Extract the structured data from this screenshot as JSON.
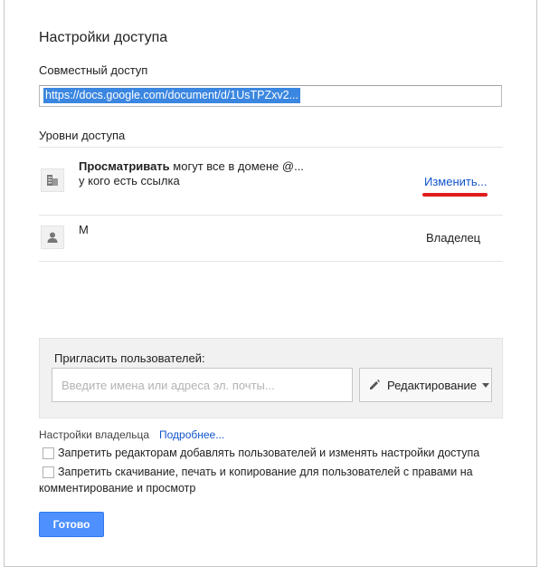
{
  "dialog": {
    "title": "Настройки доступа",
    "share_link": {
      "label": "Совместный доступ",
      "value": "https://docs.google.com/document/d/1UsTPZxv2..."
    },
    "access_levels": {
      "label": "Уровни доступа",
      "entries": [
        {
          "icon": "domain-icon",
          "permission_bold": "Просматривать",
          "description": " могут все в домене @... у кого есть ссылка",
          "action": "Изменить..."
        },
        {
          "icon": "person-icon",
          "name": "М",
          "role": "Владелец"
        }
      ]
    },
    "invite": {
      "label": "Пригласить пользователей:",
      "input_placeholder": "Введите имена или адреса эл. почты...",
      "permission_button": "Редактирование"
    },
    "owner_settings": {
      "label": "Настройки владельца",
      "more_link": "Подробнее...",
      "options": [
        {
          "checked": false,
          "text": "Запретить редакторам добавлять пользователей и изменять настройки доступа"
        },
        {
          "checked": false,
          "text": "Запретить скачивание, печать и копирование для пользователей с правами на комментирование и просмотр"
        }
      ]
    },
    "done_button": "Готово"
  },
  "colors": {
    "link": "#1155cc",
    "selection": "#3a86e0",
    "primary_button": "#4d90fe",
    "annotation": "#e01b1b"
  }
}
